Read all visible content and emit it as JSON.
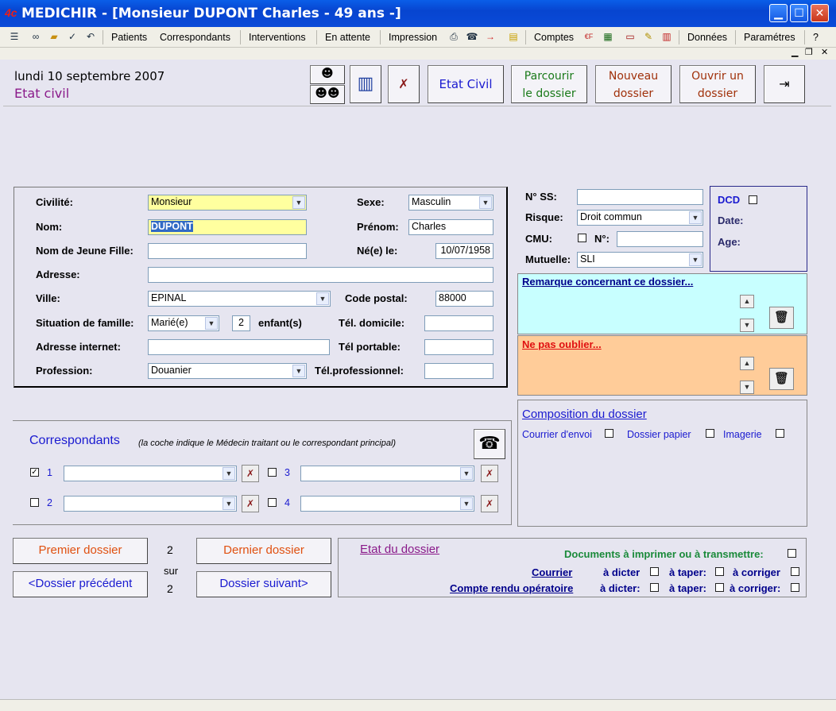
{
  "window": {
    "title": "MEDICHIR - [Monsieur DUPONT Charles - 49 ans -]",
    "logo": "4c"
  },
  "menu": {
    "items": [
      "Patients",
      "Correspondants",
      "Interventions",
      "En attente",
      "Impression",
      "Comptes",
      "Données",
      "Paramétres",
      "?"
    ]
  },
  "header": {
    "date": "lundi 10 septembre  2007",
    "section": "Etat civil"
  },
  "toolbar": {
    "etat_civil": "Etat Civil",
    "parcourir_1": "Parcourir",
    "parcourir_2": "le dossier",
    "nouveau_1": "Nouveau",
    "nouveau_2": "dossier",
    "ouvrir_1": "Ouvrir un",
    "ouvrir_2": "dossier"
  },
  "identity": {
    "civilite_label": "Civilité:",
    "civilite_value": "Monsieur",
    "sexe_label": "Sexe:",
    "sexe_value": "Masculin",
    "nom_label": "Nom:",
    "nom_value": "DUPONT",
    "prenom_label": "Prénom:",
    "prenom_value": "Charles",
    "njf_label": "Nom de Jeune Fille:",
    "njf_value": "",
    "ne_label": "Né(e) le:",
    "ne_value": "10/07/1958",
    "adresse_label": "Adresse:",
    "adresse_value": "",
    "ville_label": "Ville:",
    "ville_value": "EPINAL",
    "cp_label": "Code postal:",
    "cp_value": "88000",
    "situation_label": "Situation de famille:",
    "situation_value": "Marié(e)",
    "enfants_value": "2",
    "enfants_label": "enfant(s)",
    "tel_dom_label": "Tél. domicile:",
    "tel_dom_value": "",
    "internet_label": "Adresse internet:",
    "internet_value": "",
    "tel_port_label": "Tél portable:",
    "tel_port_value": "",
    "profession_label": "Profession:",
    "profession_value": "Douanier",
    "tel_pro_label": "Tél.professionnel:",
    "tel_pro_value": ""
  },
  "social": {
    "nss_label": "N° SS:",
    "nss_value": "",
    "risque_label": "Risque:",
    "risque_value": "Droit commun",
    "cmu_label": "CMU:",
    "cmu_n_label": "N°:",
    "cmu_n_value": "",
    "mutuelle_label": "Mutuelle:",
    "mutuelle_value": "SLI"
  },
  "dcd": {
    "dcd_label": "DCD",
    "date_label": "Date:",
    "age_label": "Age:"
  },
  "notes": {
    "remarque_title": "Remarque concernant ce dossier...",
    "oublier_title": "Ne pas oublier..."
  },
  "composition": {
    "title": "Composition du dossier",
    "courrier": "Courrier d'envoi",
    "papier": "Dossier papier",
    "imagerie": "Imagerie"
  },
  "correspondants": {
    "title": "Correspondants",
    "subtitle": "(la coche indique le Médecin traitant ou le correspondant principal)",
    "n1": "1",
    "n2": "2",
    "n3": "3",
    "n4": "4"
  },
  "navigation": {
    "premier": "Premier dossier",
    "dernier": "Dernier dossier",
    "precedent": "<Dossier précédent",
    "suivant": "Dossier suivant>",
    "current": "2",
    "sur": "sur",
    "total": "2"
  },
  "etat_dossier": {
    "title": "Etat du dossier",
    "documents": "Documents à imprimer ou à transmettre:",
    "courrier": "Courrier",
    "compte_rendu": "Compte rendu opératoire",
    "dicter": "à dicter",
    "taper": "à taper:",
    "corriger": "à corriger",
    "dicter2": "à dicter:",
    "taper2": "à taper:",
    "corriger2": "à corriger:"
  }
}
